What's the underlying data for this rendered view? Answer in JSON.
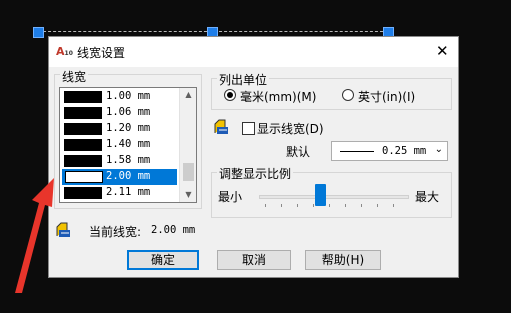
{
  "window": {
    "title": "线宽设置",
    "close_glyph": "✕"
  },
  "lineweights": {
    "legend": "线宽",
    "items": [
      {
        "label": "1.00 mm"
      },
      {
        "label": "1.06 mm"
      },
      {
        "label": "1.20 mm"
      },
      {
        "label": "1.40 mm"
      },
      {
        "label": "1.58 mm"
      },
      {
        "label": "2.00 mm",
        "selected": true
      },
      {
        "label": "2.11 mm"
      }
    ]
  },
  "units": {
    "legend": "列出单位",
    "mm_label": "毫米(mm)(M)",
    "inch_label": "英寸(in)(I)",
    "selected": "mm"
  },
  "display": {
    "checkbox_label": "显示线宽(D)",
    "checked": false
  },
  "default": {
    "label": "默认",
    "value": "0.25 mm"
  },
  "scale": {
    "legend": "调整显示比例",
    "min_label": "最小",
    "max_label": "最大"
  },
  "current": {
    "label": "当前线宽:",
    "value": "2.00 mm"
  },
  "buttons": {
    "ok": "确定",
    "cancel": "取消",
    "help": "帮助(H)"
  },
  "colors": {
    "accent": "#0078d7",
    "annotation_arrow": "#e8352b"
  }
}
